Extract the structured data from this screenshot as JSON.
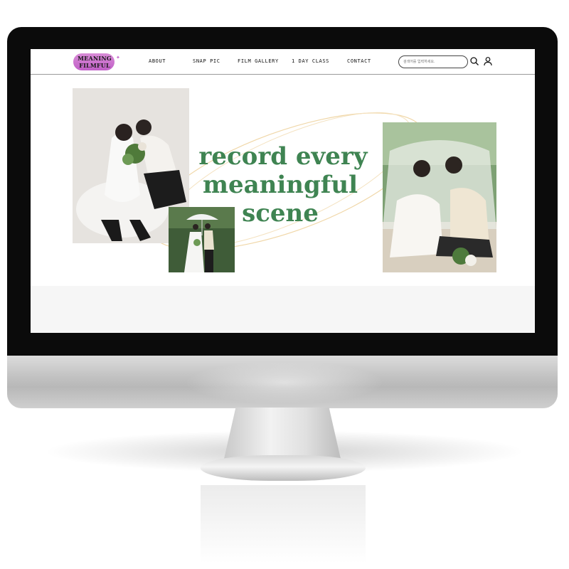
{
  "site": {
    "logo": {
      "line1": "MEANING",
      "line2": "FILMFUL"
    },
    "nav": {
      "items": [
        {
          "label": "ABOUT"
        },
        {
          "label": "SNAP PIC"
        },
        {
          "label": "FILM GALLERY"
        },
        {
          "label": "1 DAY CLASS"
        },
        {
          "label": "CONTACT"
        }
      ]
    },
    "search": {
      "placeholder": "검색어를 입력하세요."
    },
    "icons": {
      "search": "search-icon",
      "user": "user-icon"
    },
    "hero": {
      "line1": "record every",
      "line2": "meaningful scene"
    },
    "colors": {
      "accent_green": "#3f8452",
      "logo_pink": "#c15fc8",
      "orbit_gold": "#f0d7a8"
    }
  }
}
